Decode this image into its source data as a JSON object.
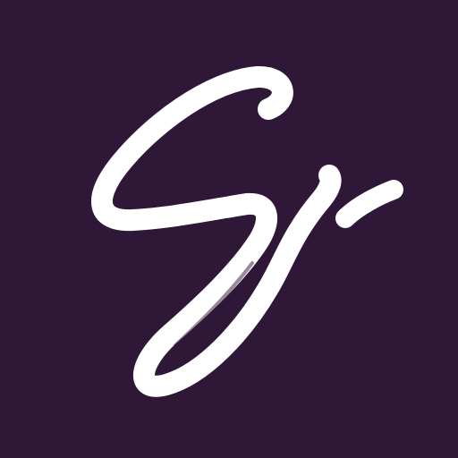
{
  "logo": {
    "mark": "S·",
    "icon": "brush-script-s-logo-icon"
  },
  "colors": {
    "background": "#2e1737",
    "stroke": "#ffffff"
  }
}
